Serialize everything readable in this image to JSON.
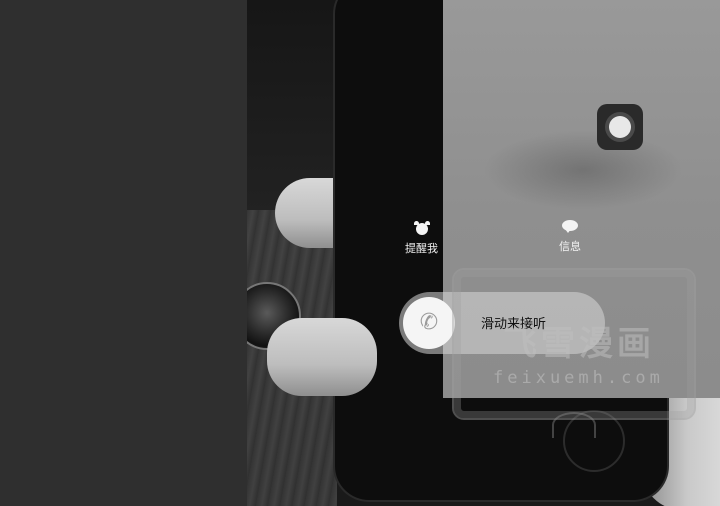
{
  "incoming_call": {
    "remind_me_label": "提醒我",
    "message_label": "信息",
    "slide_to_answer_label": "滑动来接听"
  },
  "watermark": {
    "title": "飞雪漫画",
    "url": "feixuemh.com"
  },
  "icons": {
    "remind": "alarm-clock-icon",
    "message": "speech-bubble-icon",
    "answer": "phone-handset-icon",
    "assistive_touch": "assistive-touch-icon"
  }
}
